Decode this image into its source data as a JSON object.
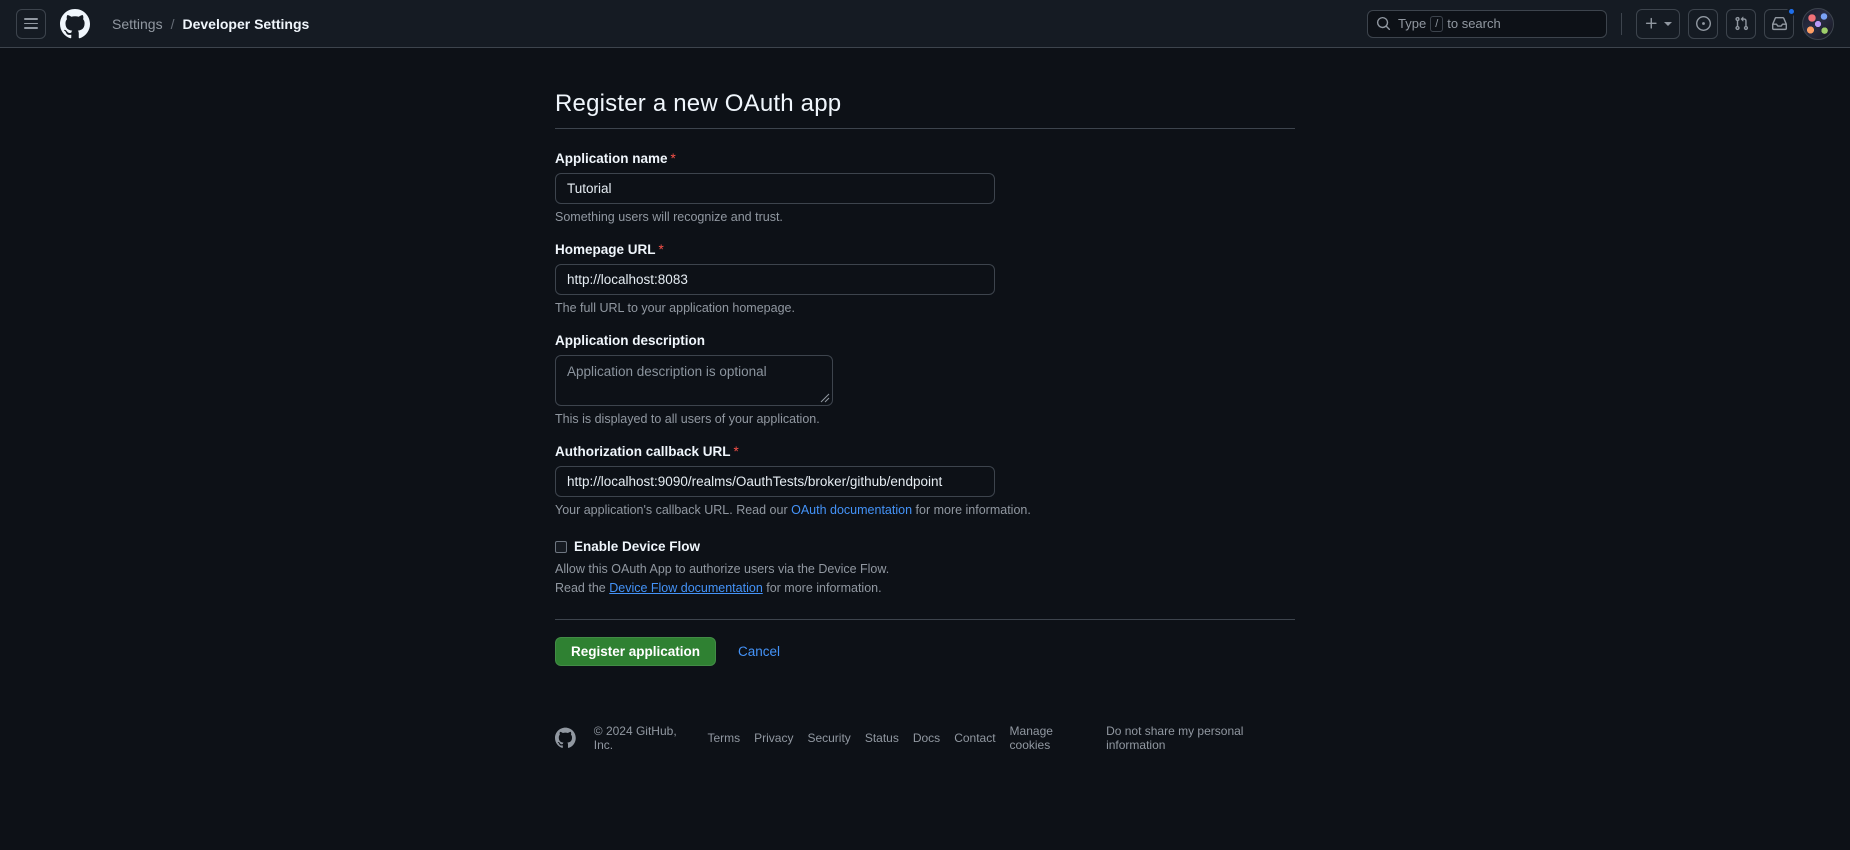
{
  "header": {
    "menu_icon": "hamburger-menu-icon",
    "logo_icon": "github-logo-icon",
    "breadcrumb": {
      "parent": "Settings",
      "separator": "/",
      "current": "Developer Settings"
    },
    "search": {
      "icon": "search-icon",
      "placeholder_prefix": "Type",
      "slash_key": "/",
      "placeholder_suffix": "to search"
    },
    "actions": {
      "create_new_icon": "plus-icon",
      "create_new_caret_icon": "chevron-down-icon",
      "issues_icon": "issue-opened-icon",
      "pull_requests_icon": "git-pull-request-icon",
      "notifications_icon": "inbox-icon",
      "avatar_icon": "user-avatar"
    }
  },
  "main": {
    "title": "Register a new OAuth app",
    "fields": {
      "app_name": {
        "label": "Application name",
        "required_marker": "*",
        "value": "Tutorial",
        "hint": "Something users will recognize and trust."
      },
      "homepage_url": {
        "label": "Homepage URL",
        "required_marker": "*",
        "value": "http://localhost:8083",
        "hint": "The full URL to your application homepage."
      },
      "app_description": {
        "label": "Application description",
        "value": "",
        "placeholder": "Application description is optional",
        "hint": "This is displayed to all users of your application."
      },
      "callback_url": {
        "label": "Authorization callback URL",
        "required_marker": "*",
        "value": "http://localhost:9090/realms/OauthTests/broker/github/endpoint",
        "hint_before": "Your application's callback URL. Read our",
        "hint_link": "OAuth documentation",
        "hint_after": "for more information."
      }
    },
    "device_flow": {
      "checkbox_label": "Enable Device Flow",
      "checked": false,
      "description": "Allow this OAuth App to authorize users via the Device Flow.",
      "doc_before": "Read the",
      "doc_link": "Device Flow documentation",
      "doc_after": "for more information."
    },
    "buttons": {
      "submit": "Register application",
      "cancel": "Cancel"
    }
  },
  "footer": {
    "logo_icon": "github-mark-icon",
    "copyright": "© 2024 GitHub, Inc.",
    "links": [
      "Terms",
      "Privacy",
      "Security",
      "Status",
      "Docs",
      "Contact",
      "Manage cookies",
      "Do not share my personal information"
    ]
  },
  "colors": {
    "page_bg": "#0d1117",
    "header_bg": "#151b23",
    "border": "#3d444d",
    "text_primary": "#f0f6fc",
    "text_muted": "#9198a1",
    "link": "#4493f8",
    "required_red": "#f85149",
    "button_green": "#2f8132",
    "notification_blue": "#1f6feb"
  }
}
